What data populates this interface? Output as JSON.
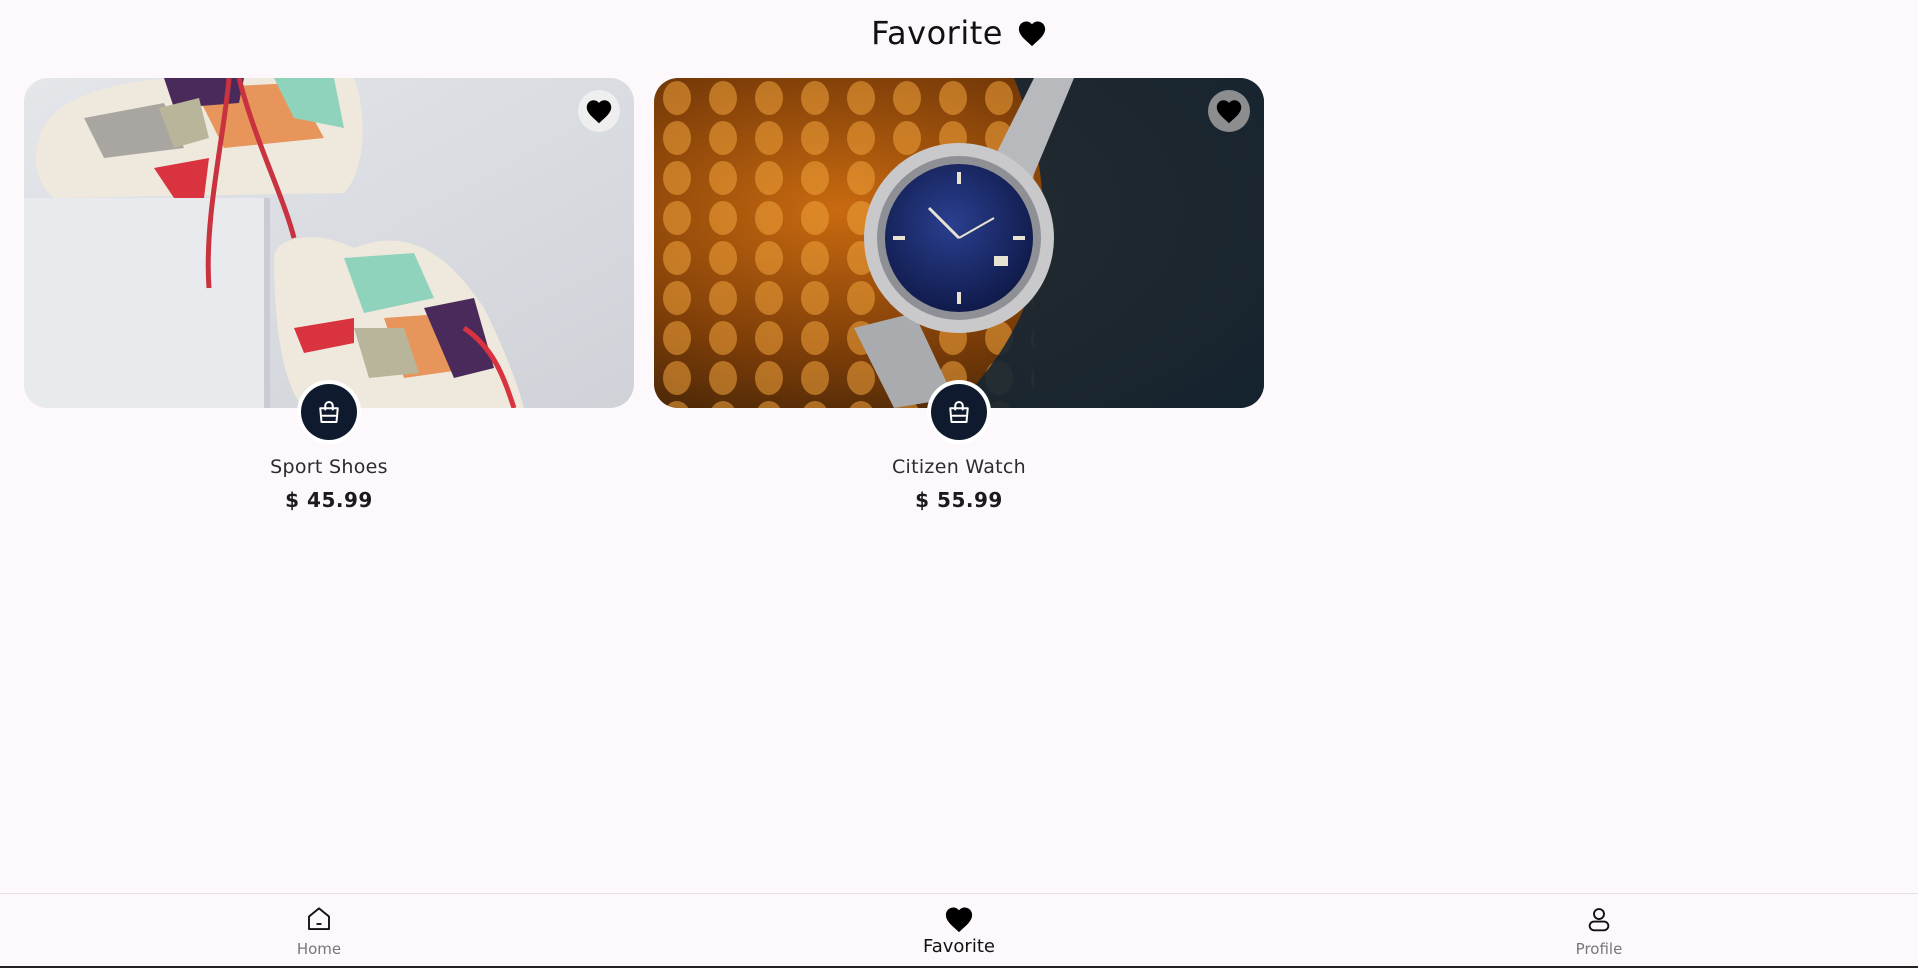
{
  "header": {
    "title": "Favorite",
    "icon": "heart-icon"
  },
  "products": [
    {
      "name": "Sport Shoes",
      "price": "$ 45.99",
      "image": "sport-shoes-photo",
      "favorited": true
    },
    {
      "name": "Citizen Watch",
      "price": "$ 55.99",
      "image": "citizen-watch-photo",
      "favorited": true
    }
  ],
  "bottom_nav": {
    "items": [
      {
        "label": "Home",
        "icon": "home-icon",
        "active": false
      },
      {
        "label": "Favorite",
        "icon": "heart-icon",
        "active": true
      },
      {
        "label": "Profile",
        "icon": "profile-icon",
        "active": false
      }
    ]
  },
  "colors": {
    "background": "#fdf8fc",
    "cart_button": "#0f1a2e",
    "text": "#1b1b1f"
  }
}
